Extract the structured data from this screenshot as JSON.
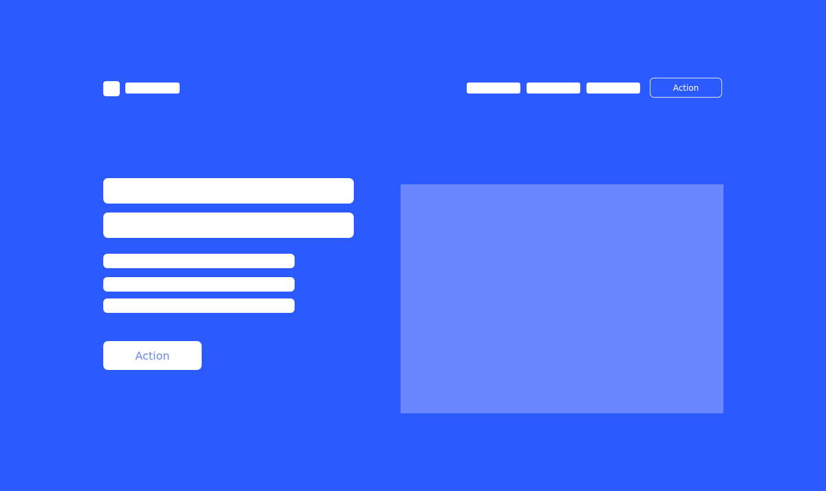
{
  "header": {
    "logo_icon": "logo-mark-icon",
    "nav_action_label": "Action"
  },
  "hero": {
    "cta_label": "Action"
  },
  "colors": {
    "background": "#2b5aff",
    "placeholder": "#ffffff",
    "media_placeholder": "#6a87ff",
    "cta_text": "#6b86f2"
  }
}
